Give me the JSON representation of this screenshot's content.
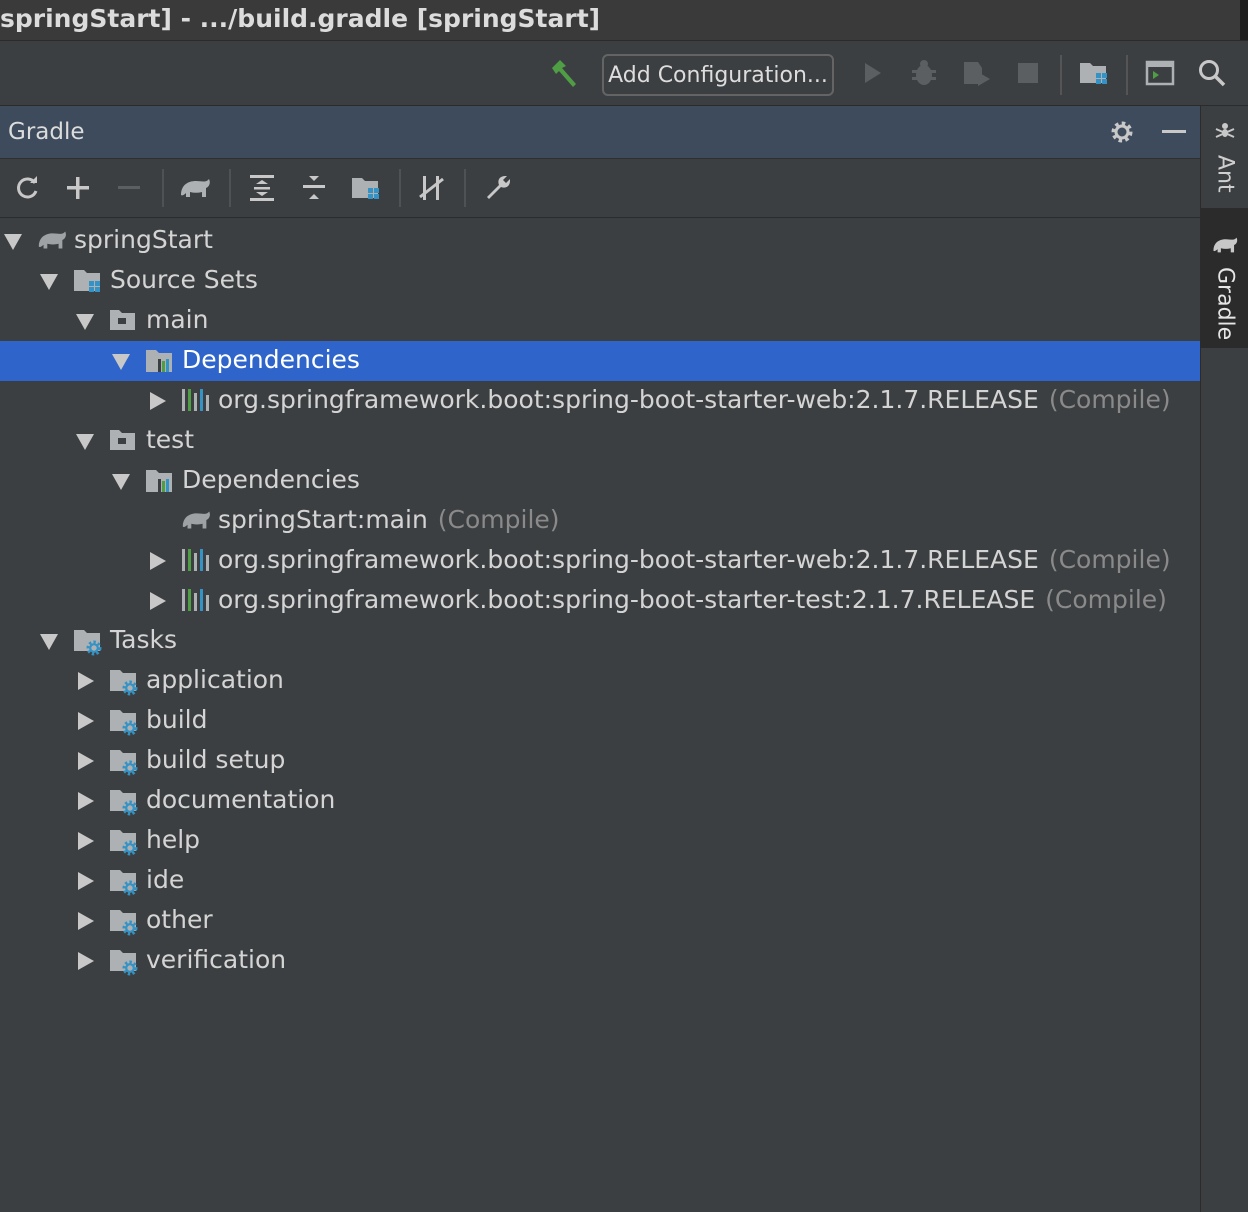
{
  "window": {
    "title": "springStart] - .../build.gradle [springStart]"
  },
  "toolbar": {
    "add_configuration_label": "Add Configuration...",
    "icons": [
      "build-hammer-icon",
      "run-icon",
      "debug-icon",
      "coverage-icon",
      "stop-icon",
      "project-structure-icon",
      "terminal-icon",
      "search-icon"
    ]
  },
  "gradle_panel": {
    "title": "Gradle",
    "header_icons": [
      "gear-icon",
      "minimize-icon"
    ],
    "toolbar_icons": [
      "refresh-icon",
      "add-icon",
      "remove-icon",
      "gradle-elephant-icon",
      "expand-all-icon",
      "collapse-all-icon",
      "source-sets-icon",
      "toggle-offline-icon",
      "wrench-icon"
    ]
  },
  "tree": {
    "items": [
      {
        "label": "springStart",
        "suffix": "",
        "level": 0,
        "expanded": true,
        "icon": "gradle-elephant-icon",
        "selected": false
      },
      {
        "label": "Source Sets",
        "suffix": "",
        "level": 1,
        "expanded": true,
        "icon": "source-sets-folder-icon",
        "selected": false
      },
      {
        "label": "main",
        "suffix": "",
        "level": 2,
        "expanded": true,
        "icon": "folder-icon",
        "selected": false
      },
      {
        "label": "Dependencies",
        "suffix": "",
        "level": 3,
        "expanded": true,
        "icon": "dependencies-folder-icon",
        "selected": true
      },
      {
        "label": "org.springframework.boot:spring-boot-starter-web:2.1.7.RELEASE",
        "suffix": "(Compile)",
        "level": 4,
        "expanded": false,
        "icon": "library-icon",
        "selected": false
      },
      {
        "label": "test",
        "suffix": "",
        "level": 2,
        "expanded": true,
        "icon": "folder-icon",
        "selected": false
      },
      {
        "label": "Dependencies",
        "suffix": "",
        "level": 3,
        "expanded": true,
        "icon": "dependencies-folder-icon",
        "selected": false
      },
      {
        "label": "springStart:main",
        "suffix": "(Compile)",
        "level": 4,
        "leaf": true,
        "icon": "gradle-elephant-icon",
        "selected": false
      },
      {
        "label": "org.springframework.boot:spring-boot-starter-web:2.1.7.RELEASE",
        "suffix": "(Compile)",
        "level": 4,
        "expanded": false,
        "icon": "library-icon",
        "selected": false
      },
      {
        "label": "org.springframework.boot:spring-boot-starter-test:2.1.7.RELEASE",
        "suffix": "(Compile)",
        "level": 4,
        "expanded": false,
        "icon": "library-icon",
        "selected": false
      },
      {
        "label": "Tasks",
        "suffix": "",
        "level": 1,
        "expanded": true,
        "icon": "tasks-folder-icon",
        "selected": false
      },
      {
        "label": "application",
        "suffix": "",
        "level": 2,
        "expanded": false,
        "icon": "tasks-folder-icon",
        "selected": false
      },
      {
        "label": "build",
        "suffix": "",
        "level": 2,
        "expanded": false,
        "icon": "tasks-folder-icon",
        "selected": false
      },
      {
        "label": "build setup",
        "suffix": "",
        "level": 2,
        "expanded": false,
        "icon": "tasks-folder-icon",
        "selected": false
      },
      {
        "label": "documentation",
        "suffix": "",
        "level": 2,
        "expanded": false,
        "icon": "tasks-folder-icon",
        "selected": false
      },
      {
        "label": "help",
        "suffix": "",
        "level": 2,
        "expanded": false,
        "icon": "tasks-folder-icon",
        "selected": false
      },
      {
        "label": "ide",
        "suffix": "",
        "level": 2,
        "expanded": false,
        "icon": "tasks-folder-icon",
        "selected": false
      },
      {
        "label": "other",
        "suffix": "",
        "level": 2,
        "expanded": false,
        "icon": "tasks-folder-icon",
        "selected": false
      },
      {
        "label": "verification",
        "suffix": "",
        "level": 2,
        "expanded": false,
        "icon": "tasks-folder-icon",
        "selected": false
      }
    ]
  },
  "side_tabs": [
    {
      "label": "Ant",
      "icon": "ant-icon",
      "active": false
    },
    {
      "label": "Gradle",
      "icon": "gradle-elephant-icon",
      "active": true
    }
  ],
  "colors": {
    "selection": "#2f65ca",
    "accent_blue": "#3592c4",
    "hammer_green": "#4f9e45",
    "panel_header": "#3d4b5c"
  }
}
